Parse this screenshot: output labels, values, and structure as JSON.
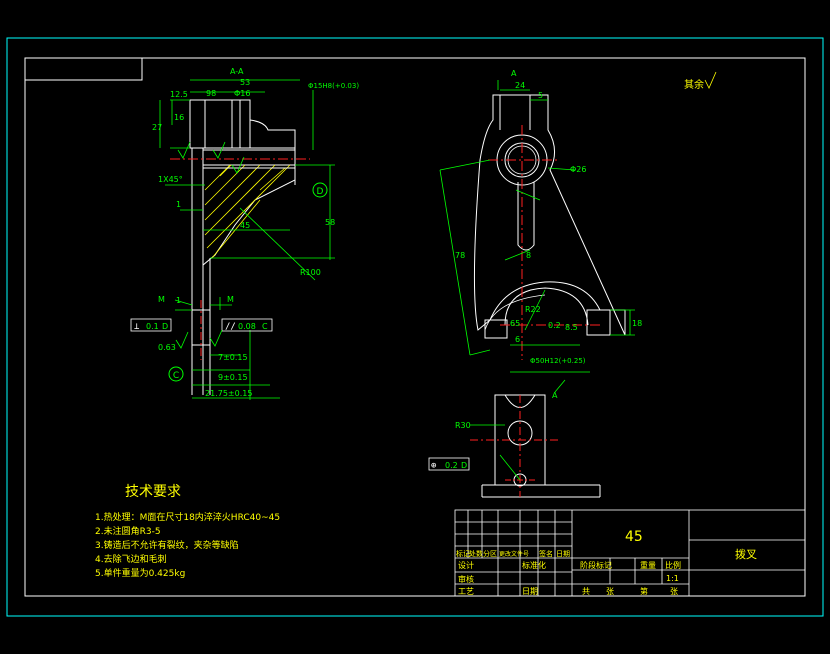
{
  "colors": {
    "background": "#000000",
    "frame": "#00ffff",
    "outline": "#ffffff",
    "dimension": "#00ff00",
    "centerline": "#ff2020",
    "hatch": "#ffff00",
    "note_text": "#ffff00",
    "datum": "#ff00ff"
  },
  "views": {
    "section_label": "A-A",
    "view_arrow_top": "A",
    "view_arrow_bottom": "A",
    "other_label": "其余"
  },
  "dims_left": {
    "d53": "53",
    "d98": "98",
    "d125": "12.5",
    "phi16": "Φ16",
    "d16": "16",
    "d27": "27",
    "chamfer": "1X45°",
    "d45": "45",
    "d58": "58",
    "d1": "1",
    "r100": "R100",
    "dia_phi": "Φ15H8(+0.03)",
    "d1b": "1",
    "m_left": "M",
    "m_right": "M",
    "tol_perp": "0.1",
    "tol_perp_ref": "D",
    "tol_par": "0.08",
    "tol_par_ref": "C",
    "d063": "0.63",
    "d7": "7±0.15",
    "d9": "9±0.15",
    "d21": "21.75±0.15",
    "datum_c": "C",
    "datum_d": "D"
  },
  "dims_right": {
    "d24": "24",
    "d5": "5",
    "phi26": "Φ26",
    "d78": "78",
    "r22": "R22",
    "d8": "8",
    "d65": "65",
    "phi50": "Φ50H12(+0.25)",
    "d18": "18",
    "d85": "8.5",
    "d6": "6",
    "r30": "R30",
    "d02": "0.2",
    "pos_tol": "0.2",
    "pos_ref": "D"
  },
  "notes": {
    "title": "技术要求",
    "items": [
      "1.热处理：M面在尺寸18内淬淬火HRC40~45",
      "2.未注圆角R3-5",
      "3.铸造后不允许有裂纹，夹杂等缺陷",
      "4.去除飞边和毛刺",
      "5.单件重量为0.425kg"
    ]
  },
  "title_block": {
    "material": "45",
    "part_name": "拨叉",
    "row_labels": [
      "标记",
      "处数",
      "分区",
      "更改文件号",
      "签名",
      "日期"
    ],
    "design": "设计",
    "standard": "标准化",
    "review": "审核",
    "process": "工艺",
    "approve": "日期",
    "stage_mark": "阶段标记",
    "weight": "重量",
    "scale": "比例",
    "scale_value": "1:1",
    "sheets_total": "共",
    "sheet_of": "第",
    "zhang1": "张",
    "zhang2": "张"
  }
}
